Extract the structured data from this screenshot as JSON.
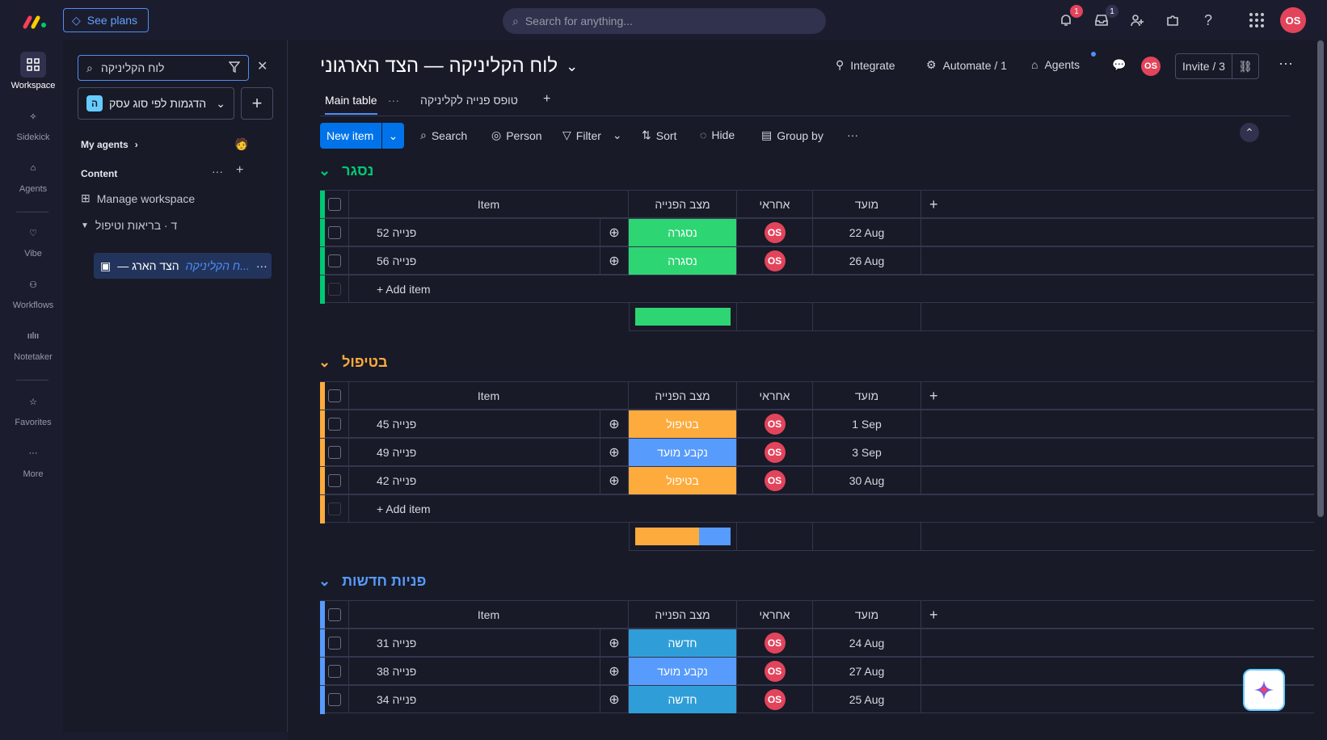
{
  "topbar": {
    "see_plans": "See plans",
    "search_placeholder": "Search for anything...",
    "notif_count": "1",
    "inbox_count": "1",
    "avatar": "OS"
  },
  "rail": [
    {
      "label": "Workspace",
      "icon": "grid-icon"
    },
    {
      "label": "Sidekick",
      "icon": "sparkle-icon"
    },
    {
      "label": "Agents",
      "icon": "agent-icon"
    },
    {
      "label": "Vibe",
      "icon": "heart-icon"
    },
    {
      "label": "Workflows",
      "icon": "workflow-icon"
    },
    {
      "label": "Notetaker",
      "icon": "waveform-icon"
    },
    {
      "label": "Favorites",
      "icon": "star-icon"
    },
    {
      "label": "More",
      "icon": "more-icon"
    }
  ],
  "sidebar": {
    "search_value": "לוח הקליניקה",
    "workspace_name": "הדגמות לפי סוג עסק",
    "workspace_badge": "ה",
    "my_agents": "My agents",
    "content": "Content",
    "manage_workspace": "Manage workspace",
    "folder": "ד · בריאות וטיפול",
    "board_highlight": "ח הקליניקה...",
    "board_rest": "— הצד הארג"
  },
  "board": {
    "title": "לוח הקליניקה — הצד הארגוני",
    "integrate": "Integrate",
    "automate": "Automate / 1",
    "agents": "Agents",
    "invite": "Invite / 3",
    "avatar": "OS",
    "tabs": [
      "Main table",
      "טופס פנייה לקליניקה"
    ],
    "toolbar": {
      "new_item": "New item",
      "search": "Search",
      "person": "Person",
      "filter": "Filter",
      "sort": "Sort",
      "hide": "Hide",
      "group_by": "Group by"
    },
    "columns": {
      "item": "Item",
      "status": "מצב הפנייה",
      "owner": "אחראי",
      "due": "מועד"
    },
    "add_item": "+ Add item",
    "groups": [
      {
        "title": "נסגר",
        "color": "#00c875",
        "rows": [
          {
            "item": "פנייה 52",
            "status": "נסגרה",
            "status_color": "#2ed573",
            "owner": "OS",
            "due": "22 Aug"
          },
          {
            "item": "פנייה 56",
            "status": "נסגרה",
            "status_color": "#2ed573",
            "owner": "OS",
            "due": "26 Aug"
          }
        ],
        "summary": [
          {
            "color": "#2ed573",
            "fraction": 1.0
          }
        ]
      },
      {
        "title": "בטיפול",
        "color": "#fdab3d",
        "rows": [
          {
            "item": "פנייה 45",
            "status": "בטיפול",
            "status_color": "#fdab3d",
            "owner": "OS",
            "due": "1 Sep"
          },
          {
            "item": "פנייה 49",
            "status": "נקבע מועד",
            "status_color": "#579bfc",
            "owner": "OS",
            "due": "3 Sep"
          },
          {
            "item": "פנייה 42",
            "status": "בטיפול",
            "status_color": "#fdab3d",
            "owner": "OS",
            "due": "30 Aug"
          }
        ],
        "summary": [
          {
            "color": "#fdab3d",
            "fraction": 0.667
          },
          {
            "color": "#579bfc",
            "fraction": 0.333
          }
        ]
      },
      {
        "title": "פניות חדשות",
        "color": "#579bfc",
        "rows": [
          {
            "item": "פנייה 31",
            "status": "חדשה",
            "status_color": "#2f9ed8",
            "owner": "OS",
            "due": "24 Aug"
          },
          {
            "item": "פנייה 38",
            "status": "נקבע מועד",
            "status_color": "#579bfc",
            "owner": "OS",
            "due": "27 Aug"
          },
          {
            "item": "פנייה 34",
            "status": "חדשה",
            "status_color": "#2f9ed8",
            "owner": "OS",
            "due": "25 Aug"
          }
        ]
      }
    ]
  }
}
